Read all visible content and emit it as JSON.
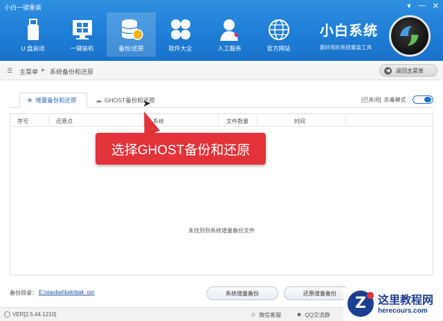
{
  "window": {
    "title": "小白一键重装",
    "controls": [
      "▾",
      "—",
      "✕"
    ]
  },
  "nav": [
    {
      "label": "U 盘启动",
      "icon": "usb-drive-icon"
    },
    {
      "label": "一键装机",
      "icon": "windows-icon"
    },
    {
      "label": "备份/还原",
      "icon": "database-backup-icon"
    },
    {
      "label": "软件大全",
      "icon": "apps-grid-icon"
    },
    {
      "label": "人工服务",
      "icon": "support-person-icon"
    },
    {
      "label": "官方网站",
      "icon": "globe-icon"
    }
  ],
  "nav_active": "备份/还原",
  "brand": {
    "name": "小白系统",
    "slogan": "最好用的系统重装工具"
  },
  "breadcrumb": {
    "home": "主菜单",
    "current": "系统备份和还原"
  },
  "back_button": "返回主菜单",
  "tabs": [
    {
      "label": "增量备份和还原",
      "active": true
    },
    {
      "label": "GHOST备份和还原",
      "active": false
    }
  ],
  "toggle": {
    "status": "[已关闭]",
    "label": "杀毒模式",
    "on": false
  },
  "table": {
    "columns": [
      "序号",
      "还原点",
      "系统",
      "文件数量",
      "时间"
    ],
    "empty_message": "未找到到系统增量备份文件"
  },
  "backup_dir": {
    "label": "备份目录：",
    "path": "E:\\xiaobai\\bak\\bak_os\\"
  },
  "actions": [
    "系统增量备份",
    "还原增量备份"
  ],
  "statusbar": {
    "version": "VER[2.5.44.1210]",
    "wechat": "微信客服",
    "qq": "QQ交流群"
  },
  "annotation": {
    "text": "选择GHOST备份和还原"
  },
  "watermark": {
    "name": "这里教程网",
    "url": "herecours.com"
  },
  "colors": {
    "header": "#1f7ed6",
    "accent": "#1f6fc9",
    "callout": "#e2333a"
  }
}
